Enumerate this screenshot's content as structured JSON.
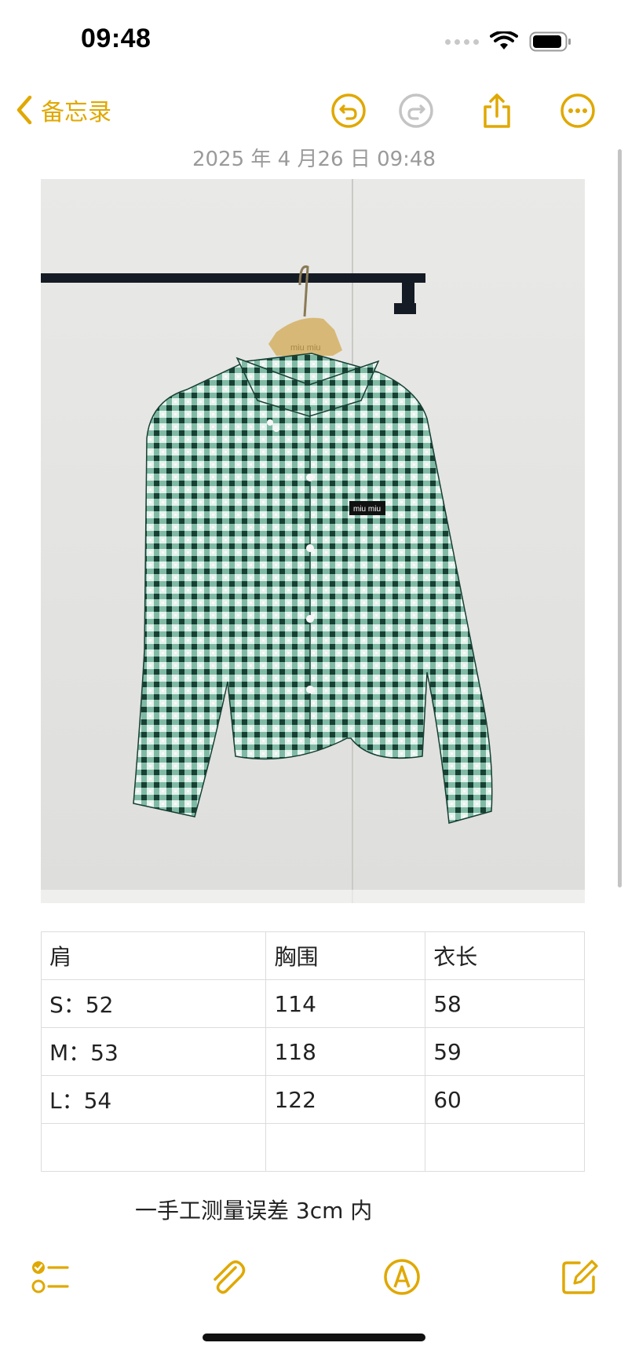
{
  "status": {
    "time": "09:48"
  },
  "nav": {
    "back_label": "备忘录"
  },
  "note": {
    "timestamp": "2025 年 4 月26 日 09:48",
    "table": {
      "rows": [
        [
          "肩",
          "胸围",
          "衣长"
        ],
        [
          "S：52",
          "114",
          "58"
        ],
        [
          "M：53",
          "118",
          "59"
        ],
        [
          "L：54",
          "122",
          "60"
        ],
        [
          "",
          "",
          ""
        ]
      ]
    },
    "text": "一手工测量误差 3cm 内",
    "image": {
      "hanger_brand": "miu miu",
      "label_brand": "miu miu"
    }
  },
  "colors": {
    "accent": "#e0a800",
    "disabled": "#c4c4c4",
    "shirt": "#2c8a6a",
    "wall": "#ebebe9"
  }
}
